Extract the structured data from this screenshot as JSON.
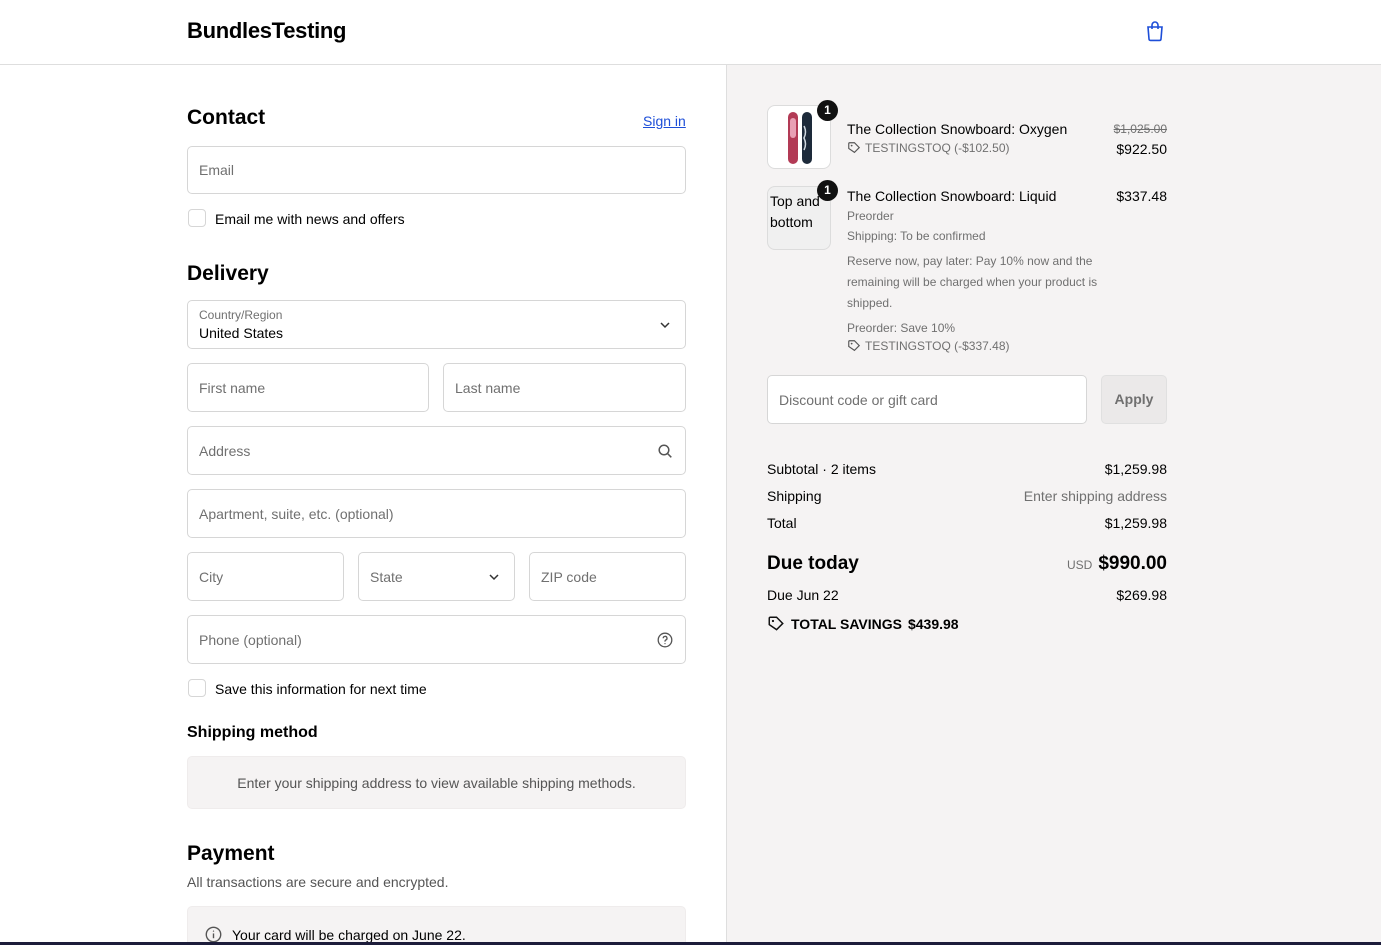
{
  "header": {
    "brand": "BundlesTesting",
    "cart_icon": "shopping-bag-icon"
  },
  "contact": {
    "title": "Contact",
    "sign_in": "Sign in",
    "email_placeholder": "Email",
    "news_checkbox_label": "Email me with news and offers"
  },
  "delivery": {
    "title": "Delivery",
    "country_label": "Country/Region",
    "country_value": "United States",
    "first_name_placeholder": "First name",
    "last_name_placeholder": "Last name",
    "address_placeholder": "Address",
    "apartment_placeholder": "Apartment, suite, etc. (optional)",
    "city_placeholder": "City",
    "state_placeholder": "State",
    "zip_placeholder": "ZIP code",
    "phone_placeholder": "Phone (optional)",
    "save_info_label": "Save this information for next time"
  },
  "shipping_method": {
    "title": "Shipping method",
    "notice": "Enter your shipping address to view available shipping methods."
  },
  "payment": {
    "title": "Payment",
    "subtitle": "All transactions are secure and encrypted.",
    "charge_notice": "Your card will be charged on June 22."
  },
  "summary": {
    "items": [
      {
        "name": "The Collection Snowboard: Oxygen",
        "quantity": "1",
        "original_price": "$1,025.00",
        "price": "$922.50",
        "discount": "TESTINGSTOQ (-$102.50)"
      },
      {
        "name": "The Collection Snowboard: Liquid",
        "quantity": "1",
        "image_alt": "Top and bottom",
        "price": "$337.48",
        "preorder": "Preorder",
        "shipping_note": "Shipping: To be confirmed",
        "reserve_line1": "Reserve now, pay later: Pay 10% now and the",
        "reserve_line2": "remaining will be charged when your product is",
        "reserve_line3": "shipped.",
        "save_note": "Preorder: Save 10%",
        "discount": "TESTINGSTOQ (-$337.48)"
      }
    ],
    "discount_placeholder": "Discount code or gift card",
    "apply_label": "Apply",
    "subtotal_label": "Subtotal · 2 items",
    "subtotal_value": "$1,259.98",
    "shipping_label": "Shipping",
    "shipping_value": "Enter shipping address",
    "total_label": "Total",
    "total_value": "$1,259.98",
    "due_today_label": "Due today",
    "due_today_currency": "USD",
    "due_today_value": "$990.00",
    "due_later_label": "Due Jun 22",
    "due_later_value": "$269.98",
    "savings_label": "TOTAL SAVINGS",
    "savings_value": "$439.98"
  },
  "colors": {
    "link": "#1d4ed8",
    "summary_bg": "#f5f3f3",
    "badge": "#111111"
  }
}
